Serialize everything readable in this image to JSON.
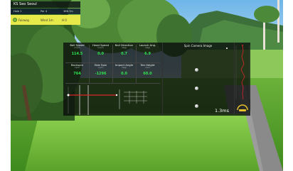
{
  "course": {
    "name": "KS Seo Seoul",
    "hole": "Hole 1",
    "par": "Par 4",
    "distance": "366.7m",
    "lie": "Fairway",
    "extra": "Wind 1m",
    "extra2": "H 0"
  },
  "metrics": [
    {
      "label": "Ball Speed",
      "unit": "(mph)",
      "value": "114.5"
    },
    {
      "label": "Head Speed",
      "unit": "(mph)",
      "value": "0.0"
    },
    {
      "label": "Ball Direction",
      "unit": "(deg)",
      "value": "0.7"
    },
    {
      "label": "Launch Ang.",
      "unit": "(deg)",
      "value": "6.9"
    },
    {
      "label": "Backspin",
      "unit": "(rpm)",
      "value": "764"
    },
    {
      "label": "Side Spin",
      "unit": "(rpm)",
      "value": "-1296"
    },
    {
      "label": "Impact Angle",
      "unit": "(deg)",
      "value": "0.0"
    },
    {
      "label": "Tee Height",
      "unit": "(mm)",
      "value": "60.0"
    }
  ],
  "spin_camera": {
    "title": "Spin Camera Image",
    "time": "1.3ms"
  },
  "colors": {
    "value_green": "#2ee34e",
    "path_red": "#d9242a",
    "course_bar_yellow": "#e7e84a"
  },
  "icons": {
    "lie": "fairway-ball-icon",
    "brand": "simulator-logo-icon"
  }
}
